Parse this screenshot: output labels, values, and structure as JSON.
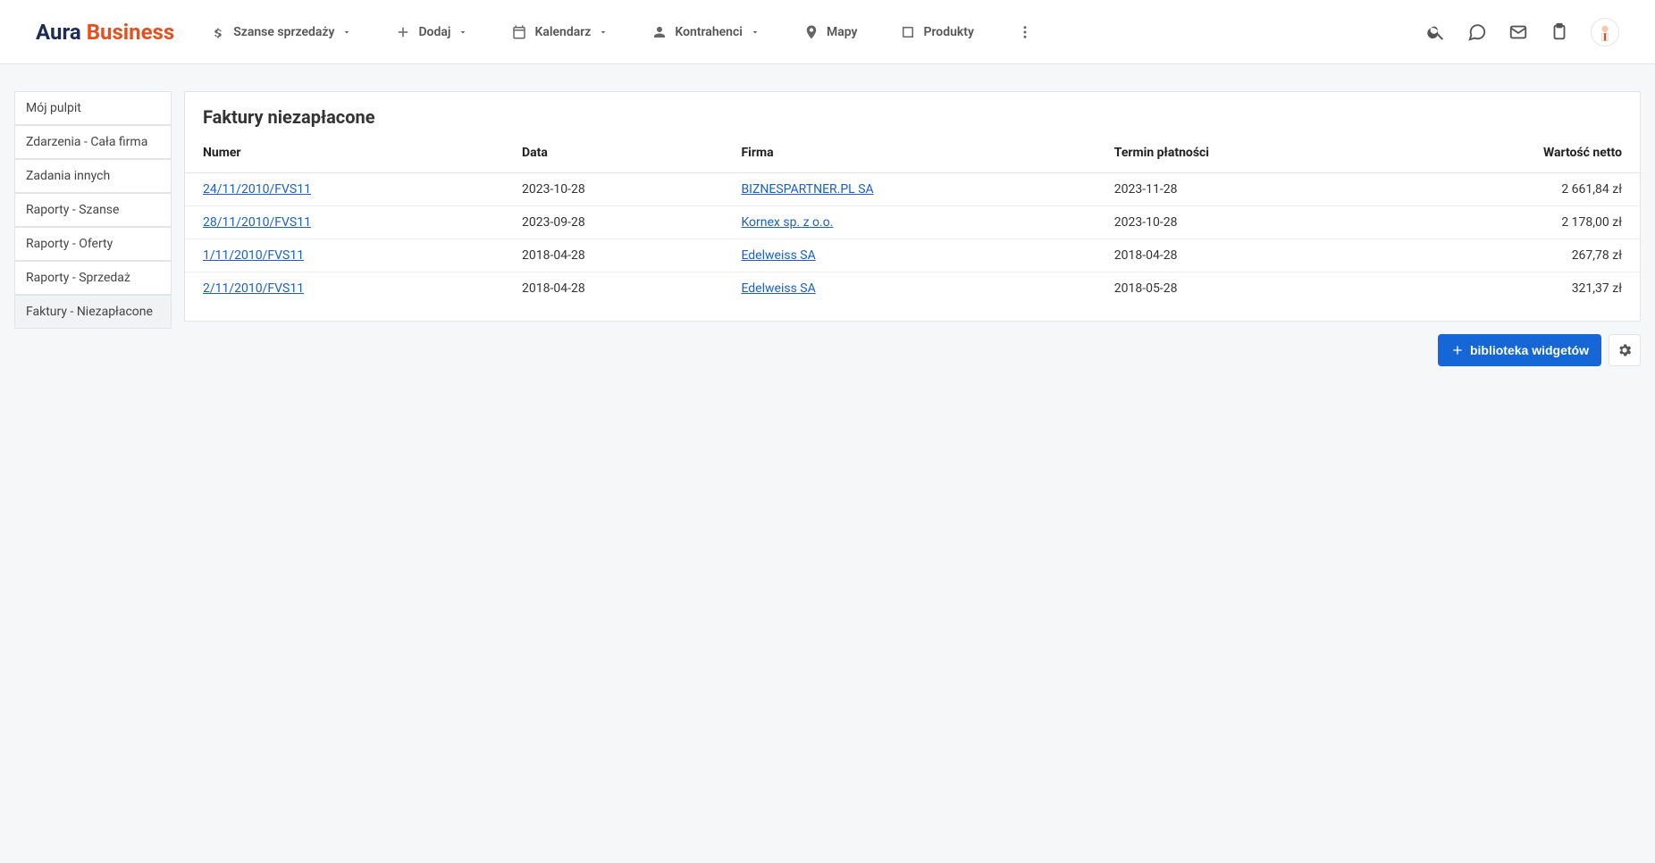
{
  "brand": {
    "part1": "Aura",
    "part2": "Business"
  },
  "nav": {
    "sales_chances": "Szanse sprzedaży",
    "add": "Dodaj",
    "calendar": "Kalendarz",
    "contractors": "Kontrahenci",
    "maps": "Mapy",
    "products": "Produkty"
  },
  "sidebar": {
    "items": [
      {
        "label": "Mój pulpit"
      },
      {
        "label": "Zdarzenia - Cała firma"
      },
      {
        "label": "Zadania innych"
      },
      {
        "label": "Raporty - Szanse"
      },
      {
        "label": "Raporty - Oferty"
      },
      {
        "label": "Raporty - Sprzedaż"
      },
      {
        "label": "Faktury - Niezapłacone"
      }
    ],
    "active_index": 6
  },
  "widget": {
    "title": "Faktury niezapłacone",
    "columns": {
      "number": "Numer",
      "date": "Data",
      "company": "Firma",
      "due_date": "Termin płatności",
      "net_value": "Wartość netto"
    },
    "rows": [
      {
        "number": "24/11/2010/FVS11",
        "date": "2023-10-28",
        "company": "BIZNESPARTNER.PL SA",
        "due": "2023-11-28",
        "value": "2 661,84 zł"
      },
      {
        "number": "28/11/2010/FVS11",
        "date": "2023-09-28",
        "company": "Kornex sp. z o.o.",
        "due": "2023-10-28",
        "value": "2 178,00 zł"
      },
      {
        "number": "1/11/2010/FVS11",
        "date": "2018-04-28",
        "company": "Edelweiss SA",
        "due": "2018-04-28",
        "value": "267,78 zł"
      },
      {
        "number": "2/11/2010/FVS11",
        "date": "2018-04-28",
        "company": "Edelweiss SA",
        "due": "2018-05-28",
        "value": "321,37 zł"
      }
    ]
  },
  "actions": {
    "widget_library": "biblioteka widgetów"
  }
}
